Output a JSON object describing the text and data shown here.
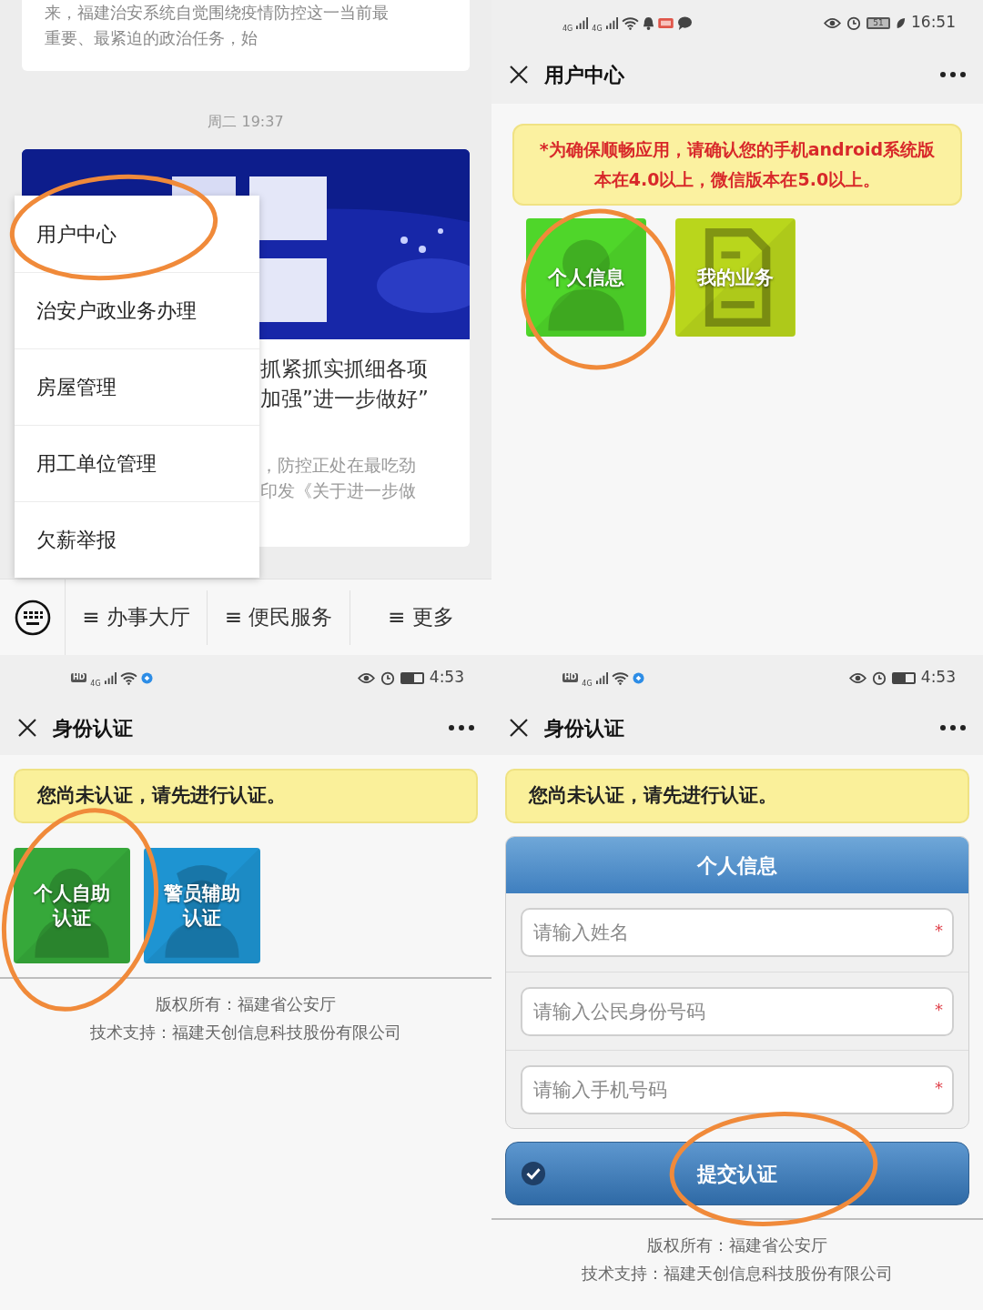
{
  "chat_panel": {
    "previous_article_lines": [
      "来，福建治安系统自觉围绕疫情防控这一当前最",
      "重要、最紧迫的政治任务，始"
    ],
    "timestamp": "周二 19:37",
    "article": {
      "title_lines": [
        "抓紧抓实抓细各项",
        "加强”进一步做好”"
      ],
      "summary_lines": [
        "，防控正处在最吃劲",
        "印发《关于进一步做"
      ]
    },
    "popup_menu": [
      {
        "label": "用户中心"
      },
      {
        "label": "治安户政业务办理"
      },
      {
        "label": "房屋管理"
      },
      {
        "label": "用工单位管理"
      },
      {
        "label": "欠薪举报"
      }
    ],
    "bottom_menu": [
      {
        "label": "≡ 办事大厅"
      },
      {
        "label": "≡ 便民服务"
      },
      {
        "label": "≡ 更多"
      }
    ]
  },
  "user_center_panel": {
    "status_bar": {
      "network_labels": [
        "4G",
        "4G"
      ],
      "battery_text": "51",
      "time": "16:51"
    },
    "title": "用户中心",
    "notice": "*为确保顺畅应用，请确认您的手机android系统版本在4.0以上，微信版本在5.0以上。",
    "tiles": [
      {
        "label": "个人信息",
        "kind": "person",
        "color": "#4fd62a"
      },
      {
        "label": "我的业务",
        "kind": "document",
        "color": "#b9d61c"
      }
    ]
  },
  "identity_panel": {
    "status_bar": {
      "hd_label": "HD",
      "network_labels": [
        "4G"
      ],
      "time": "4:53"
    },
    "title": "身份认证",
    "notice": "您尚未认证，请先进行认证。",
    "tiles": [
      {
        "label": "个人自助认证",
        "kind": "person",
        "color": "#36a83a"
      },
      {
        "label": "警员辅助认证",
        "kind": "officer",
        "color": "#1e94d2"
      }
    ],
    "footer_lines": [
      "版权所有：福建省公安厅",
      "技术支持：福建天创信息科技股份有限公司"
    ]
  },
  "identity_form_panel": {
    "status_bar": {
      "hd_label": "HD",
      "network_labels": [
        "4G"
      ],
      "time": "4:53"
    },
    "title": "身份认证",
    "notice": "您尚未认证，请先进行认证。",
    "form_title": "个人信息",
    "fields": [
      {
        "placeholder": "请输入姓名",
        "required_mark": "*"
      },
      {
        "placeholder": "请输入公民身份号码",
        "required_mark": "*"
      },
      {
        "placeholder": "请输入手机号码",
        "required_mark": "*"
      }
    ],
    "submit_button": "提交认证",
    "footer_lines": [
      "版权所有：福建省公安厅",
      "技术支持：福建天创信息科技股份有限公司"
    ]
  }
}
